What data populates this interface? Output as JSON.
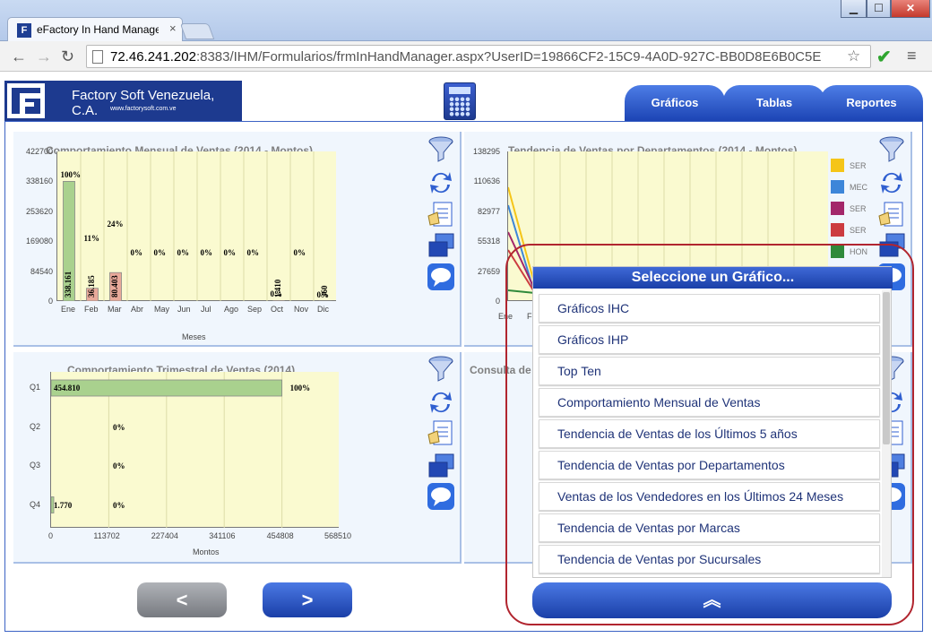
{
  "browser": {
    "tab_title": "eFactory In Hand Manage",
    "tab_close": "×",
    "url_host": "72.46.241.202",
    "url_rest": ":8383/IHM/Formularios/frmInHandManager.aspx?UserID=19866CF2-15C9-4A0D-927C-BB0D8E6B0C5E",
    "win_min": "▁",
    "win_max": "☐",
    "win_close": "✕",
    "back_icon": "←",
    "forward_icon": "→",
    "reload_icon": "↻",
    "star_icon": "☆",
    "ext_icon": "✔",
    "menu_icon": "≡"
  },
  "header": {
    "company": "Factory Soft Venezuela, C.A.",
    "website": "www.factorysoft.com.ve",
    "tabs": [
      "Gráficos",
      "Tablas",
      "Reportes"
    ]
  },
  "panels": {
    "monthly": {
      "title": "Comportamiento Mensual de Ventas (2014 - Montos)",
      "y_ticks": [
        "422700",
        "338160",
        "253620",
        "169080",
        "84540",
        "0"
      ],
      "xlabel": "Meses"
    },
    "trend": {
      "title": "Tendencia de Ventas por Departamentos (2014 - Montos)",
      "y_ticks": [
        "138295",
        "110636",
        "82977",
        "55318",
        "27659",
        "0"
      ],
      "x_ticks": [
        "Ene",
        "Fe"
      ],
      "legend": [
        {
          "label": "SER",
          "color": "#f5c518"
        },
        {
          "label": "MEC",
          "color": "#3d86d9"
        },
        {
          "label": "SER",
          "color": "#a3276a"
        },
        {
          "label": "SER",
          "color": "#cc3b40"
        },
        {
          "label": "HON",
          "color": "#2f8a3b"
        }
      ]
    },
    "quarterly": {
      "title": "Comportamiento Trimestral de Ventas (2014)",
      "xlabel": "Montos",
      "x_ticks": [
        "0",
        "113702",
        "227404",
        "341106",
        "454808",
        "568510"
      ]
    },
    "consulta": {
      "title": "Consulta de"
    }
  },
  "popup": {
    "title": "Seleccione un Gráfico...",
    "items": [
      "Gráficos IHC",
      "Gráficos IHP",
      "Top Ten",
      "Comportamiento Mensual de Ventas",
      "Tendencia de Ventas de los Últimos 5 años",
      "Tendencia de Ventas por Departamentos",
      "Ventas de los Vendedores en los Últimos 24 Meses",
      "Tendencia de Ventas por Marcas",
      "Tendencia de Ventas por Sucursales"
    ],
    "collapse_icon": "︽"
  },
  "pager": {
    "prev": "<",
    "next": ">"
  },
  "chart_data": [
    {
      "type": "bar",
      "title": "Comportamiento Mensual de Ventas (2014 - Montos)",
      "xlabel": "Meses",
      "ylabel": "",
      "ylim": [
        0,
        422700
      ],
      "categories": [
        "Ene",
        "Feb",
        "Mar",
        "Abr",
        "May",
        "Jun",
        "Jul",
        "Ago",
        "Sep",
        "Oct",
        "Nov",
        "Dic"
      ],
      "values": [
        338161,
        36185,
        80403,
        0,
        0,
        0,
        0,
        0,
        0,
        1410,
        0,
        360
      ],
      "value_labels": [
        "338.161",
        "36.185",
        "80.403",
        "",
        "",
        "",
        "",
        "",
        "",
        "1.410",
        "",
        "360"
      ],
      "percent_labels": [
        "100%",
        "11%",
        "24%",
        "0%",
        "0%",
        "0%",
        "0%",
        "0%",
        "0%",
        "0%",
        "0%",
        "0%"
      ],
      "colors": [
        "#a9d18e",
        "#e8a99a",
        "#e8a99a",
        "#e8a99a",
        "#e8a99a",
        "#e8a99a",
        "#e8a99a",
        "#e8a99a",
        "#e8a99a",
        "#e8a99a",
        "#e8a99a",
        "#e8a99a"
      ],
      "grid": true
    },
    {
      "type": "line",
      "title": "Tendencia de Ventas por Departamentos (2014 - Montos)",
      "ylim": [
        0,
        138295
      ],
      "legend": [
        "SER",
        "MEC",
        "SER",
        "SER",
        "HON"
      ]
    },
    {
      "type": "bar",
      "orientation": "horizontal",
      "title": "Comportamiento Trimestral de Ventas (2014)",
      "xlabel": "Montos",
      "xlim": [
        0,
        568510
      ],
      "categories": [
        "Q1",
        "Q2",
        "Q3",
        "Q4"
      ],
      "values": [
        454810,
        0,
        0,
        1770
      ],
      "value_labels": [
        "454.810",
        "",
        "",
        "1.770"
      ],
      "percent_labels": [
        "100%",
        "0%",
        "0%",
        "0%"
      ],
      "colors": [
        "#a9d18e",
        "#a9d18e",
        "#a9d18e",
        "#a9d18e"
      ],
      "grid": true
    }
  ]
}
